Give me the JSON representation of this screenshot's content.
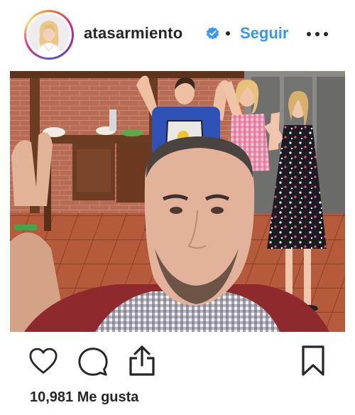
{
  "post": {
    "username": "atasarmiento",
    "follow_label": "Seguir",
    "likes_count": "10,981",
    "likes_label": "Me gusta",
    "verified": true
  },
  "icons": {
    "verified": "verified-badge-icon",
    "more": "more-options-icon",
    "like": "heart-icon",
    "comment": "comment-bubble-icon",
    "share": "share-upload-icon",
    "save": "bookmark-icon"
  },
  "colors": {
    "link_blue": "#3897f0",
    "text": "#262626",
    "verified_blue": "#3897f0"
  }
}
